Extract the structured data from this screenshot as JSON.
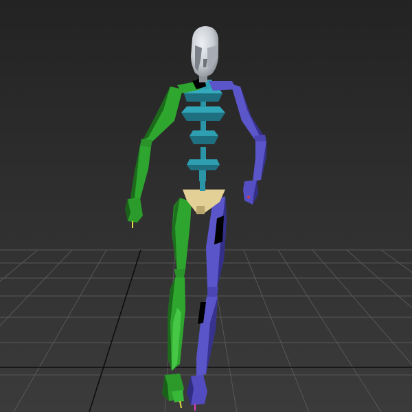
{
  "viewport": {
    "background_top": "#242424",
    "background_bottom": "#3a3a3a",
    "grid_color": "#5a5a5a",
    "grid_axis_color": "#0a0a0a"
  },
  "biped": {
    "colors": {
      "head": "#c9cdd3",
      "head_shade": "#9aa0a8",
      "spine": "#2d9fb0",
      "spine_dark": "#1d6f7d",
      "pelvis": "#e2cf94",
      "left_side": "#2fa52f",
      "left_side_dark": "#1b6d1b",
      "right_side": "#5b55c8",
      "right_side_dark": "#35308a",
      "toe_tip": "#e7d94a",
      "toe_tip_pink": "#d640c0",
      "finger_tip_red": "#d63a4a"
    }
  }
}
